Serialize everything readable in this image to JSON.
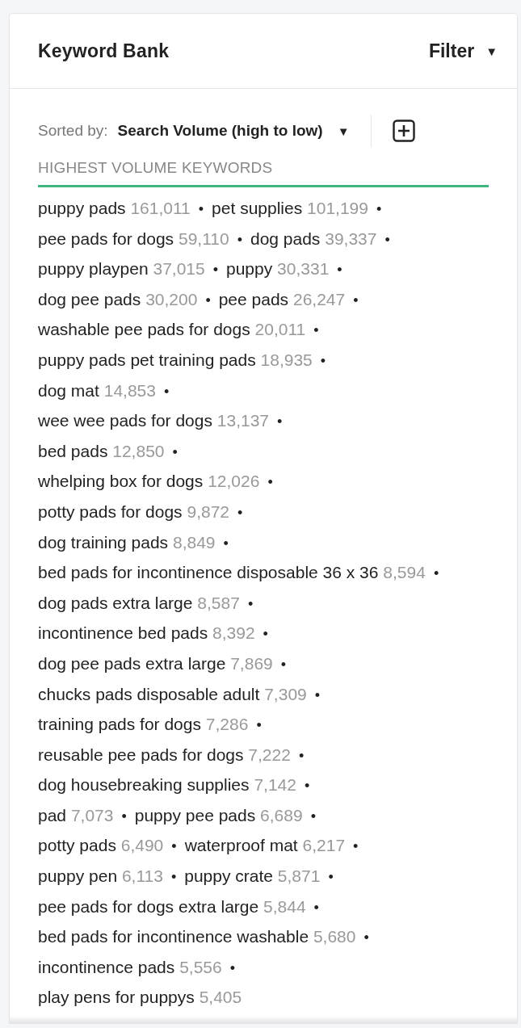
{
  "panel": {
    "title": "Keyword Bank",
    "filter": {
      "label": "Filter",
      "icon": "▼"
    }
  },
  "sort": {
    "label": "Sorted by:",
    "value": "Search Volume (high to low)",
    "icon": "▼"
  },
  "section": {
    "title": "HIGHEST VOLUME KEYWORDS"
  },
  "rows": [
    {
      "items": [
        {
          "keyword": "puppy pads",
          "volume": "161,011",
          "separator": "•"
        },
        {
          "keyword": "pet supplies",
          "volume": "101,199",
          "separator": "•"
        }
      ]
    },
    {
      "items": [
        {
          "keyword": "pee pads for dogs",
          "volume": "59,110",
          "separator": "•"
        },
        {
          "keyword": "dog pads",
          "volume": "39,337",
          "separator": "•"
        }
      ]
    },
    {
      "items": [
        {
          "keyword": "puppy playpen",
          "volume": "37,015",
          "separator": "•"
        },
        {
          "keyword": "puppy",
          "volume": "30,331",
          "separator": "•"
        }
      ]
    },
    {
      "items": [
        {
          "keyword": "dog pee pads",
          "volume": "30,200",
          "separator": "•"
        },
        {
          "keyword": "pee pads",
          "volume": "26,247",
          "separator": "•"
        }
      ]
    },
    {
      "items": [
        {
          "keyword": "washable pee pads for dogs",
          "volume": "20,011",
          "separator": "•"
        }
      ]
    },
    {
      "items": [
        {
          "keyword": "puppy pads pet training pads",
          "volume": "18,935",
          "separator": "•"
        }
      ]
    },
    {
      "items": [
        {
          "keyword": "dog mat",
          "volume": "14,853",
          "separator": "•"
        }
      ]
    },
    {
      "items": [
        {
          "keyword": "wee wee pads for dogs",
          "volume": "13,137",
          "separator": "•"
        }
      ]
    },
    {
      "items": [
        {
          "keyword": "bed pads",
          "volume": "12,850",
          "separator": "•"
        }
      ]
    },
    {
      "items": [
        {
          "keyword": "whelping box for dogs",
          "volume": "12,026",
          "separator": "•"
        }
      ]
    },
    {
      "items": [
        {
          "keyword": "potty pads for dogs",
          "volume": "9,872",
          "separator": "•"
        }
      ]
    },
    {
      "items": [
        {
          "keyword": "dog training pads",
          "volume": "8,849",
          "separator": "•"
        }
      ]
    },
    {
      "items": [
        {
          "keyword": "bed pads for incontinence disposable 36 x 36",
          "volume": "8,594",
          "separator": "•"
        }
      ]
    },
    {
      "items": [
        {
          "keyword": "dog pads extra large",
          "volume": "8,587",
          "separator": "•"
        }
      ]
    },
    {
      "items": [
        {
          "keyword": "incontinence bed pads",
          "volume": "8,392",
          "separator": "•"
        }
      ]
    },
    {
      "items": [
        {
          "keyword": "dog pee pads extra large",
          "volume": "7,869",
          "separator": "•"
        }
      ]
    },
    {
      "items": [
        {
          "keyword": "chucks pads disposable adult",
          "volume": "7,309",
          "separator": "•"
        }
      ]
    },
    {
      "items": [
        {
          "keyword": "training pads for dogs",
          "volume": "7,286",
          "separator": "•"
        }
      ]
    },
    {
      "items": [
        {
          "keyword": "reusable pee pads for dogs",
          "volume": "7,222",
          "separator": "•"
        }
      ]
    },
    {
      "items": [
        {
          "keyword": "dog housebreaking supplies",
          "volume": "7,142",
          "separator": "•"
        }
      ]
    },
    {
      "items": [
        {
          "keyword": "pad",
          "volume": "7,073",
          "separator": "•"
        },
        {
          "keyword": "puppy pee pads",
          "volume": "6,689",
          "separator": "•"
        }
      ]
    },
    {
      "items": [
        {
          "keyword": "potty pads",
          "volume": "6,490",
          "separator": "•"
        },
        {
          "keyword": "waterproof mat",
          "volume": "6,217",
          "separator": "•"
        }
      ]
    },
    {
      "items": [
        {
          "keyword": "puppy pen",
          "volume": "6,113",
          "separator": "•"
        },
        {
          "keyword": "puppy crate",
          "volume": "5,871",
          "separator": "•"
        }
      ]
    },
    {
      "items": [
        {
          "keyword": "pee pads for dogs extra large",
          "volume": "5,844",
          "separator": "•"
        }
      ]
    },
    {
      "items": [
        {
          "keyword": "bed pads for incontinence washable",
          "volume": "5,680",
          "separator": "•"
        }
      ]
    },
    {
      "items": [
        {
          "keyword": "incontinence pads",
          "volume": "5,556",
          "separator": "•"
        }
      ]
    },
    {
      "items": [
        {
          "keyword": "play pens for puppys",
          "volume": "5,405"
        }
      ]
    }
  ]
}
